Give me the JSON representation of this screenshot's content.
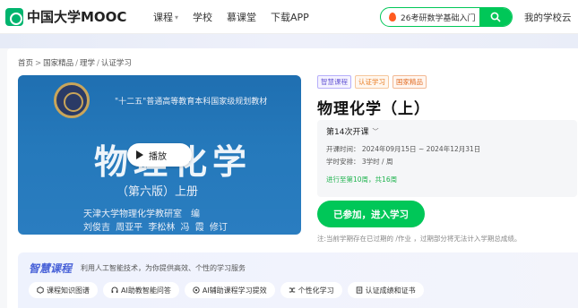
{
  "header": {
    "logo_text": "中国大学MOOC",
    "nav": [
      {
        "label": "课程",
        "has_caret": true
      },
      {
        "label": "学校",
        "has_caret": false
      },
      {
        "label": "慕课堂",
        "has_caret": false
      },
      {
        "label": "下载APP",
        "has_caret": false
      }
    ],
    "search_text": "26考研数学基础入门",
    "my_school": "我的学校云"
  },
  "breadcrumb": [
    "首页",
    "国家精品",
    "理学",
    "认证学习"
  ],
  "cover": {
    "series_text": "\"十二五\"普通高等教育本科国家级规划教材",
    "title": "物理化学",
    "edition": "（第六版）上册",
    "author": "天津大学物理化学教研室　编",
    "editors": "刘俊吉 周亚平 李松林 冯 霞 修订",
    "play_label": "播放"
  },
  "course": {
    "tags": [
      "智慧课程",
      "认证学习",
      "国家精品"
    ],
    "title": "物理化学（上）",
    "session": "第14次开课",
    "time": "开课时间： 2024年09月15日 ~ 2024年12月31日",
    "hours": "学时安排： 3学时 / 周",
    "progress": "进行至第10周，共16周",
    "join_label": "已参加，进入学习",
    "notice": "注:当前学期存在已过期的 /作业 ，过期部分将无法计入学期总成绩。"
  },
  "smart": {
    "title": "智慧课程",
    "desc": "利用人工智能技术，为你提供高效、个性的学习服务",
    "items": [
      "课程知识图谱",
      "AI助教智能问答",
      "AI辅助课程学习提效",
      "个性化学习",
      "认证成绩和证书"
    ]
  },
  "colors": {
    "brand": "#00c758",
    "accent_blue": "#4a63d8",
    "cover_blue": "#2579bb"
  }
}
